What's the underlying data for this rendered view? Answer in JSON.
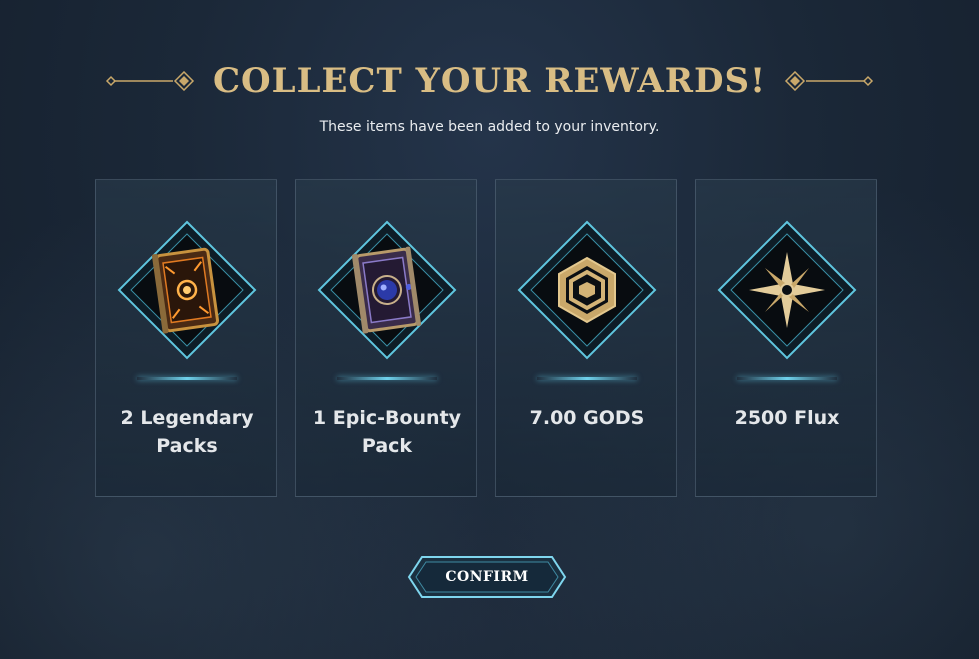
{
  "header": {
    "title": "COLLECT YOUR REWARDS!",
    "subtitle": "These items have been added to your inventory."
  },
  "rewards": [
    {
      "label": "2 Legendary Packs",
      "icon": "legendary-pack-icon"
    },
    {
      "label": "1 Epic-Bounty Pack",
      "icon": "epic-bounty-pack-icon"
    },
    {
      "label": "7.00 GODS",
      "icon": "gods-token-icon"
    },
    {
      "label": "2500 Flux",
      "icon": "flux-star-icon"
    }
  ],
  "confirm_label": "CONFIRM",
  "colors": {
    "gold": "#d9bd84",
    "teal_accent": "#6fd2ec",
    "background": "#1b2838"
  }
}
